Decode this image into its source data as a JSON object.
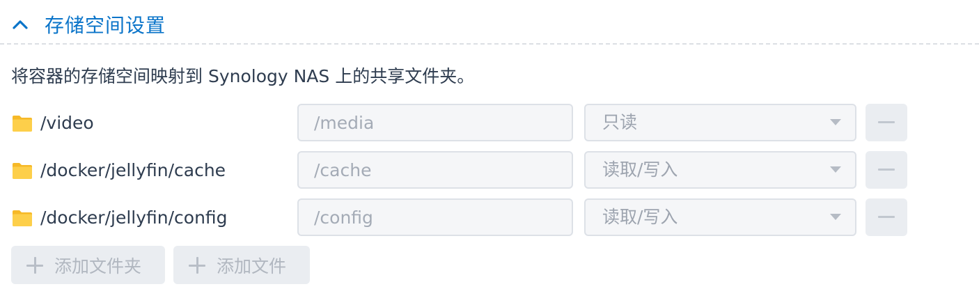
{
  "section": {
    "title": "存储空间设置",
    "toggle_icon": "chevron-up-icon",
    "accent_color": "#0a74c9"
  },
  "description": "将容器的存储空间映射到 Synology NAS 上的共享文件夹。",
  "volumes": [
    {
      "host_path": "/video",
      "mount_path": "/media",
      "permission": "只读",
      "icon": "folder-icon"
    },
    {
      "host_path": "/docker/jellyfin/cache",
      "mount_path": "/cache",
      "permission": "读取/写入",
      "icon": "folder-icon"
    },
    {
      "host_path": "/docker/jellyfin/config",
      "mount_path": "/config",
      "permission": "读取/写入",
      "icon": "folder-icon"
    }
  ],
  "actions": {
    "add_folder_label": "添加文件夹",
    "add_file_label": "添加文件"
  },
  "colors": {
    "folder": "#fcc93b",
    "field_background": "#f5f6f8",
    "button_background": "#eaedf1"
  }
}
